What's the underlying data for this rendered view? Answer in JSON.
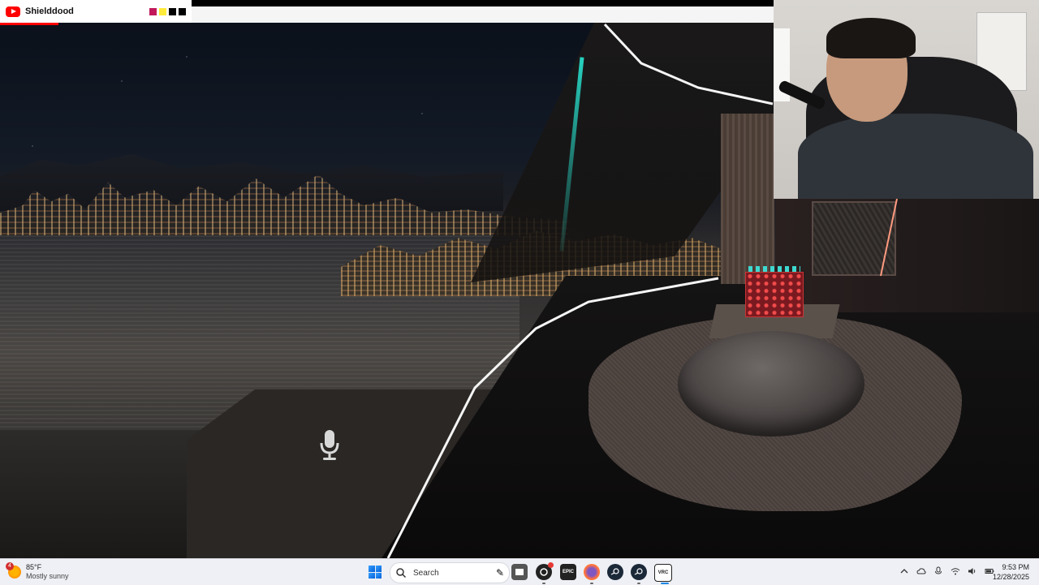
{
  "youtube_overlay": {
    "channel_name": "Shielddood",
    "color_squares": [
      "#c2185b",
      "#ffeb3b",
      "#000000",
      "#000000"
    ],
    "accent_color": "#ff0000"
  },
  "taskbar": {
    "weather": {
      "temperature": "85°F",
      "description": "Mostly sunny",
      "badge_count": "4"
    },
    "search": {
      "placeholder": "Search"
    },
    "apps": [
      {
        "name": "file-explorer",
        "label": ""
      },
      {
        "name": "obs-studio",
        "label": ""
      },
      {
        "name": "epic-games",
        "label": "EPIC"
      },
      {
        "name": "firefox",
        "label": ""
      },
      {
        "name": "steam",
        "label": ""
      },
      {
        "name": "steam-vr",
        "label": ""
      },
      {
        "name": "vrchat",
        "label": "VRC"
      }
    ],
    "clock": {
      "time": "9:53 PM",
      "date": "12/28/2025"
    }
  }
}
